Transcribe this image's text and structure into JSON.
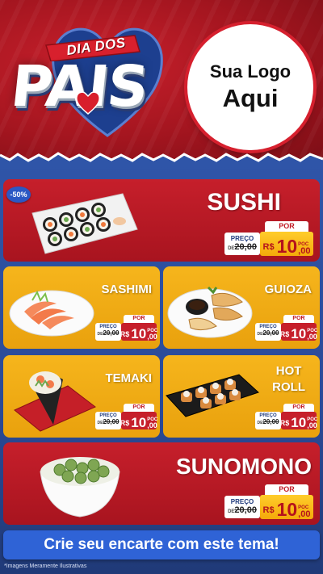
{
  "header": {
    "banner_text": "DIA DOS",
    "main_text": "PAIS",
    "logo_line1": "Sua Logo",
    "logo_line2": "Aqui"
  },
  "discount_badge": "-50%",
  "products": {
    "sushi": {
      "name": "SUSHI",
      "por": "POR",
      "preco_label": "PREÇO",
      "old_prefix": "DE",
      "old_price": "20,00",
      "currency": "R$",
      "price_int": "10",
      "price_cents": ",00",
      "poc": "POC"
    },
    "sashimi": {
      "name": "SASHIMI",
      "por": "POR",
      "preco_label": "PREÇO",
      "old_prefix": "DE",
      "old_price": "20,00",
      "currency": "R$",
      "price_int": "10",
      "price_cents": ",00",
      "poc": "POC"
    },
    "guioza": {
      "name": "GUIOZA",
      "por": "POR",
      "preco_label": "PREÇO",
      "old_prefix": "DE",
      "old_price": "20,00",
      "currency": "R$",
      "price_int": "10",
      "price_cents": ",00",
      "poc": "POC"
    },
    "temaki": {
      "name": "TEMAKI",
      "por": "POR",
      "preco_label": "PREÇO",
      "old_prefix": "DE",
      "old_price": "20,00",
      "currency": "R$",
      "price_int": "10",
      "price_cents": ",00",
      "poc": "POC"
    },
    "hotroll": {
      "name_line1": "HOT",
      "name_line2": "ROLL",
      "por": "POR",
      "preco_label": "PREÇO",
      "old_prefix": "DE",
      "old_price": "20,00",
      "currency": "R$",
      "price_int": "10",
      "price_cents": ",00",
      "poc": "POC"
    },
    "sunomono": {
      "name": "SUNOMONO",
      "por": "POR",
      "preco_label": "PREÇO",
      "old_prefix": "DE",
      "old_price": "20,00",
      "currency": "R$",
      "price_int": "10",
      "price_cents": ",00",
      "poc": "POC"
    }
  },
  "cta": "Crie seu encarte com este tema!",
  "footnote": "*Imagens Meramente Ilustrativas",
  "colors": {
    "red": "#c61f2b",
    "yellow": "#f4b21a",
    "blue": "#2f55a8",
    "price_yellow": "#ffcd2b"
  }
}
